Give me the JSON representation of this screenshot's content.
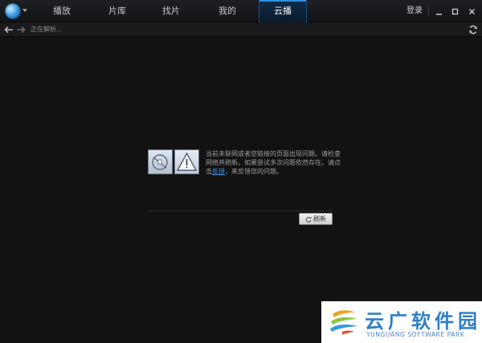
{
  "titlebar": {
    "tabs": [
      {
        "label": "播放"
      },
      {
        "label": "片库"
      },
      {
        "label": "找片"
      },
      {
        "label": "我的"
      },
      {
        "label": "云播"
      }
    ],
    "active_tab": "云播",
    "login_label": "登录"
  },
  "navbar": {
    "status_text": "正在解析..."
  },
  "error": {
    "line_part1": "当前未联网或者您链接的页面出现问题。请检查网络并刷新。如果尝试多次问题依然存在。请点击",
    "feedback_link": "反馈",
    "line_part2": "，来反馈您的问题。",
    "refresh_label": "刷新"
  },
  "watermark": {
    "title": "云广软件园",
    "subtitle": "YUNGUANG SOFTWARE PARK"
  },
  "colors": {
    "accent": "#2f8fe0",
    "link": "#3d96e6",
    "background": "#121212"
  }
}
